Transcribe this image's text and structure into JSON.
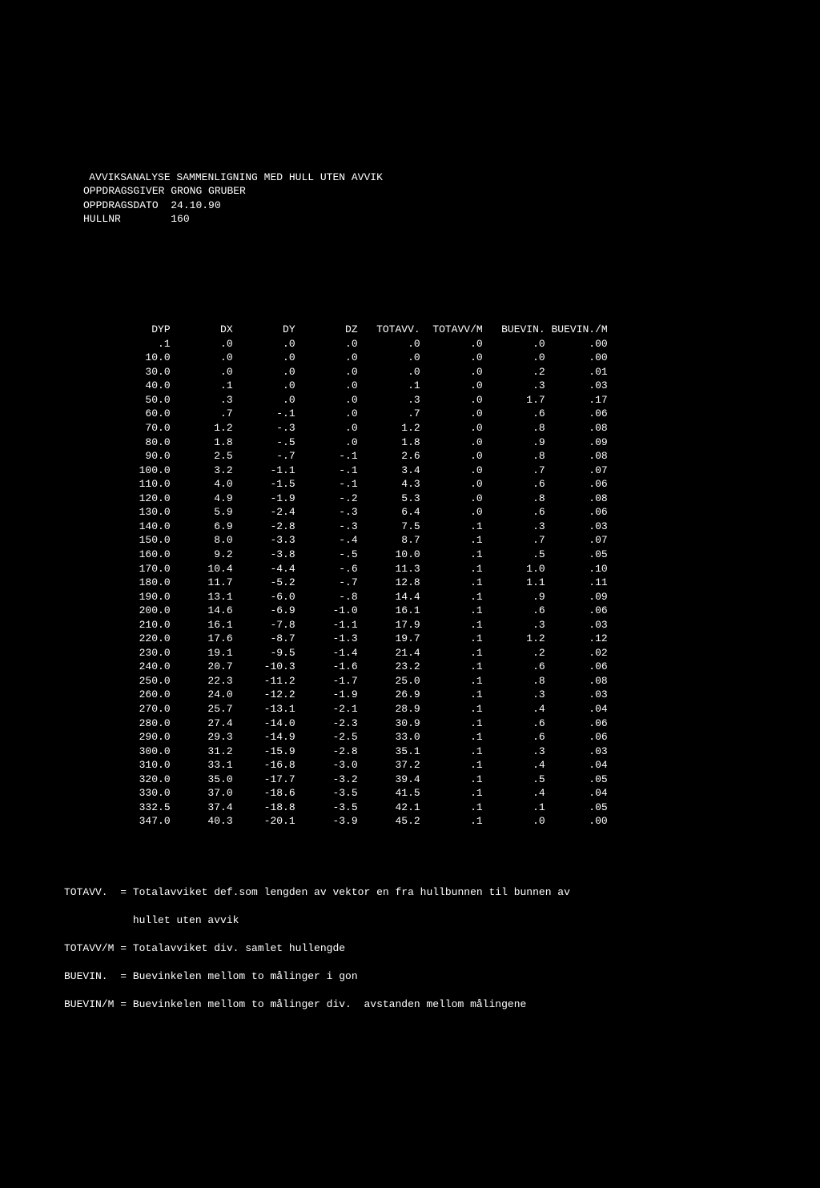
{
  "header": {
    "title": "AVVIKSANALYSE SAMMENLIGNING MED HULL UTEN AVVIK",
    "lines": [
      {
        "label": "OPPDRAGSGIVER",
        "value": "GRONG GRUBER"
      },
      {
        "label": "OPPDRAGSDATO",
        "value": "24.10.90"
      },
      {
        "label": "HULLNR",
        "value": "160"
      }
    ]
  },
  "columns": [
    "DYP",
    "DX",
    "DY",
    "DZ",
    "TOTAVV.",
    "TOTAVV/M",
    "BUEVIN.",
    "BUEVIN./M"
  ],
  "rows": [
    [
      ".1",
      ".0",
      ".0",
      ".0",
      ".0",
      ".0",
      ".0",
      ".00"
    ],
    [
      "10.0",
      ".0",
      ".0",
      ".0",
      ".0",
      ".0",
      ".0",
      ".00"
    ],
    [
      "30.0",
      ".0",
      ".0",
      ".0",
      ".0",
      ".0",
      ".2",
      ".01"
    ],
    [
      "40.0",
      ".1",
      ".0",
      ".0",
      ".1",
      ".0",
      ".3",
      ".03"
    ],
    [
      "50.0",
      ".3",
      ".0",
      ".0",
      ".3",
      ".0",
      "1.7",
      ".17"
    ],
    [
      "60.0",
      ".7",
      "-.1",
      ".0",
      ".7",
      ".0",
      ".6",
      ".06"
    ],
    [
      "70.0",
      "1.2",
      "-.3",
      ".0",
      "1.2",
      ".0",
      ".8",
      ".08"
    ],
    [
      "80.0",
      "1.8",
      "-.5",
      ".0",
      "1.8",
      ".0",
      ".9",
      ".09"
    ],
    [
      "90.0",
      "2.5",
      "-.7",
      "-.1",
      "2.6",
      ".0",
      ".8",
      ".08"
    ],
    [
      "100.0",
      "3.2",
      "-1.1",
      "-.1",
      "3.4",
      ".0",
      ".7",
      ".07"
    ],
    [
      "110.0",
      "4.0",
      "-1.5",
      "-.1",
      "4.3",
      ".0",
      ".6",
      ".06"
    ],
    [
      "120.0",
      "4.9",
      "-1.9",
      "-.2",
      "5.3",
      ".0",
      ".8",
      ".08"
    ],
    [
      "130.0",
      "5.9",
      "-2.4",
      "-.3",
      "6.4",
      ".0",
      ".6",
      ".06"
    ],
    [
      "140.0",
      "6.9",
      "-2.8",
      "-.3",
      "7.5",
      ".1",
      ".3",
      ".03"
    ],
    [
      "150.0",
      "8.0",
      "-3.3",
      "-.4",
      "8.7",
      ".1",
      ".7",
      ".07"
    ],
    [
      "160.0",
      "9.2",
      "-3.8",
      "-.5",
      "10.0",
      ".1",
      ".5",
      ".05"
    ],
    [
      "170.0",
      "10.4",
      "-4.4",
      "-.6",
      "11.3",
      ".1",
      "1.0",
      ".10"
    ],
    [
      "180.0",
      "11.7",
      "-5.2",
      "-.7",
      "12.8",
      ".1",
      "1.1",
      ".11"
    ],
    [
      "190.0",
      "13.1",
      "-6.0",
      "-.8",
      "14.4",
      ".1",
      ".9",
      ".09"
    ],
    [
      "200.0",
      "14.6",
      "-6.9",
      "-1.0",
      "16.1",
      ".1",
      ".6",
      ".06"
    ],
    [
      "210.0",
      "16.1",
      "-7.8",
      "-1.1",
      "17.9",
      ".1",
      ".3",
      ".03"
    ],
    [
      "220.0",
      "17.6",
      "-8.7",
      "-1.3",
      "19.7",
      ".1",
      "1.2",
      ".12"
    ],
    [
      "230.0",
      "19.1",
      "-9.5",
      "-1.4",
      "21.4",
      ".1",
      ".2",
      ".02"
    ],
    [
      "240.0",
      "20.7",
      "-10.3",
      "-1.6",
      "23.2",
      ".1",
      ".6",
      ".06"
    ],
    [
      "250.0",
      "22.3",
      "-11.2",
      "-1.7",
      "25.0",
      ".1",
      ".8",
      ".08"
    ],
    [
      "260.0",
      "24.0",
      "-12.2",
      "-1.9",
      "26.9",
      ".1",
      ".3",
      ".03"
    ],
    [
      "270.0",
      "25.7",
      "-13.1",
      "-2.1",
      "28.9",
      ".1",
      ".4",
      ".04"
    ],
    [
      "280.0",
      "27.4",
      "-14.0",
      "-2.3",
      "30.9",
      ".1",
      ".6",
      ".06"
    ],
    [
      "290.0",
      "29.3",
      "-14.9",
      "-2.5",
      "33.0",
      ".1",
      ".6",
      ".06"
    ],
    [
      "300.0",
      "31.2",
      "-15.9",
      "-2.8",
      "35.1",
      ".1",
      ".3",
      ".03"
    ],
    [
      "310.0",
      "33.1",
      "-16.8",
      "-3.0",
      "37.2",
      ".1",
      ".4",
      ".04"
    ],
    [
      "320.0",
      "35.0",
      "-17.7",
      "-3.2",
      "39.4",
      ".1",
      ".5",
      ".05"
    ],
    [
      "330.0",
      "37.0",
      "-18.6",
      "-3.5",
      "41.5",
      ".1",
      ".4",
      ".04"
    ],
    [
      "332.5",
      "37.4",
      "-18.8",
      "-3.5",
      "42.1",
      ".1",
      ".1",
      ".05"
    ],
    [
      "347.0",
      "40.3",
      "-20.1",
      "-3.9",
      "45.2",
      ".1",
      ".0",
      ".00"
    ]
  ],
  "definitions": [
    {
      "term": "TOTAVV.  ",
      "text": "= Totalavviket def.som lengden av vektor en fra hullbunnen til bunnen av"
    },
    {
      "term": "           ",
      "text": "hullet uten avvik"
    },
    {
      "term": "TOTAVV/M ",
      "text": "= Totalavviket div. samlet hullengde"
    },
    {
      "term": "BUEVIN.  ",
      "text": "= Buevinkelen mellom to målinger i gon"
    },
    {
      "term": "BUEVIN/M ",
      "text": "= Buevinkelen mellom to målinger div.  avstanden mellom målingene"
    }
  ]
}
